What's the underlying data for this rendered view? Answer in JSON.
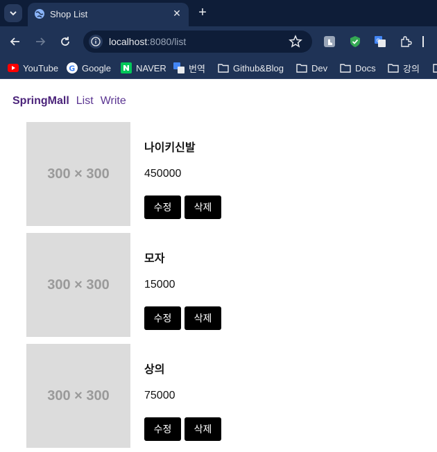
{
  "browser": {
    "tab_title": "Shop List",
    "url_host": "localhost",
    "url_path": ":8080/list",
    "bookmarks": [
      "YouTube",
      "Google",
      "NAVER",
      "번역",
      "Github&Blog",
      "Dev",
      "Docs",
      "강의"
    ]
  },
  "site": {
    "logo": "SpringMall",
    "nav": [
      "List",
      "Write"
    ]
  },
  "products": [
    {
      "name": "나이키신발",
      "price": "450000",
      "image_text": "300 × 300",
      "edit_label": "수정",
      "delete_label": "삭제"
    },
    {
      "name": "모자",
      "price": "15000",
      "image_text": "300 × 300",
      "edit_label": "수정",
      "delete_label": "삭제"
    },
    {
      "name": "상의",
      "price": "75000",
      "image_text": "300 × 300",
      "edit_label": "수정",
      "delete_label": "삭제"
    }
  ],
  "colors": {
    "chrome_dark": "#0e1d38",
    "chrome": "#1f3356",
    "brand": "#4b237a",
    "button_bg": "#000000"
  }
}
